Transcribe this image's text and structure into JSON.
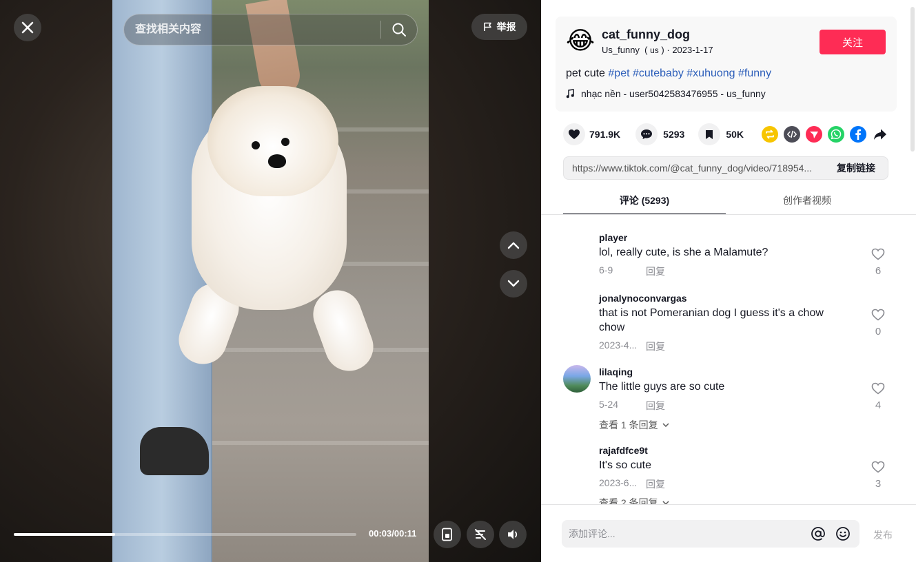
{
  "player": {
    "search_placeholder": "查找相关内容",
    "report_label": "举报",
    "time_display": "00:03/00:11",
    "progress_fraction": 0.296
  },
  "author": {
    "avatar_emoji": "😂",
    "name": "cat_funny_dog",
    "nickname": "Us_funny",
    "region": "us",
    "date": "2023-1-17",
    "follow_label": "关注"
  },
  "description": {
    "text": "pet cute",
    "hashtags": [
      "#pet",
      "#cutebaby",
      "#xuhuong",
      "#funny"
    ],
    "music": "nhạc nền - user5042583476955 - us_funny"
  },
  "stats": {
    "likes": "791.9K",
    "comments": "5293",
    "saves": "50K"
  },
  "share_colors": {
    "repost": "#f7c500",
    "embed": "#4d4d57",
    "send": "#fe2c55",
    "whatsapp": "#25d366",
    "facebook": "#0075fa"
  },
  "link": {
    "url": "https://www.tiktok.com/@cat_funny_dog/video/718954...",
    "copy_label": "复制链接"
  },
  "tabs": {
    "comments": "评论 (5293)",
    "creator_videos": "创作者视频"
  },
  "comments": [
    {
      "user": "player",
      "text": "lol, really cute, is she a Malamute?",
      "date": "6-9",
      "reply": "回复",
      "likes": "6",
      "more": ""
    },
    {
      "user": "jonalynoconvargas",
      "text": "that is not Pomeranian dog I guess it's a chow chow",
      "date": "2023-4...",
      "reply": "回复",
      "likes": "0",
      "more": ""
    },
    {
      "user": "lilaqing",
      "text": "The little guys are so cute",
      "date": "5-24",
      "reply": "回复",
      "likes": "4",
      "more": "查看 1 条回复"
    },
    {
      "user": "rajafdfce9t",
      "text": "It's so cute",
      "date": "2023-6...",
      "reply": "回复",
      "likes": "3",
      "more": "查看 2 条回复"
    }
  ],
  "comment_bar": {
    "placeholder": "添加评论...",
    "post_label": "发布"
  }
}
